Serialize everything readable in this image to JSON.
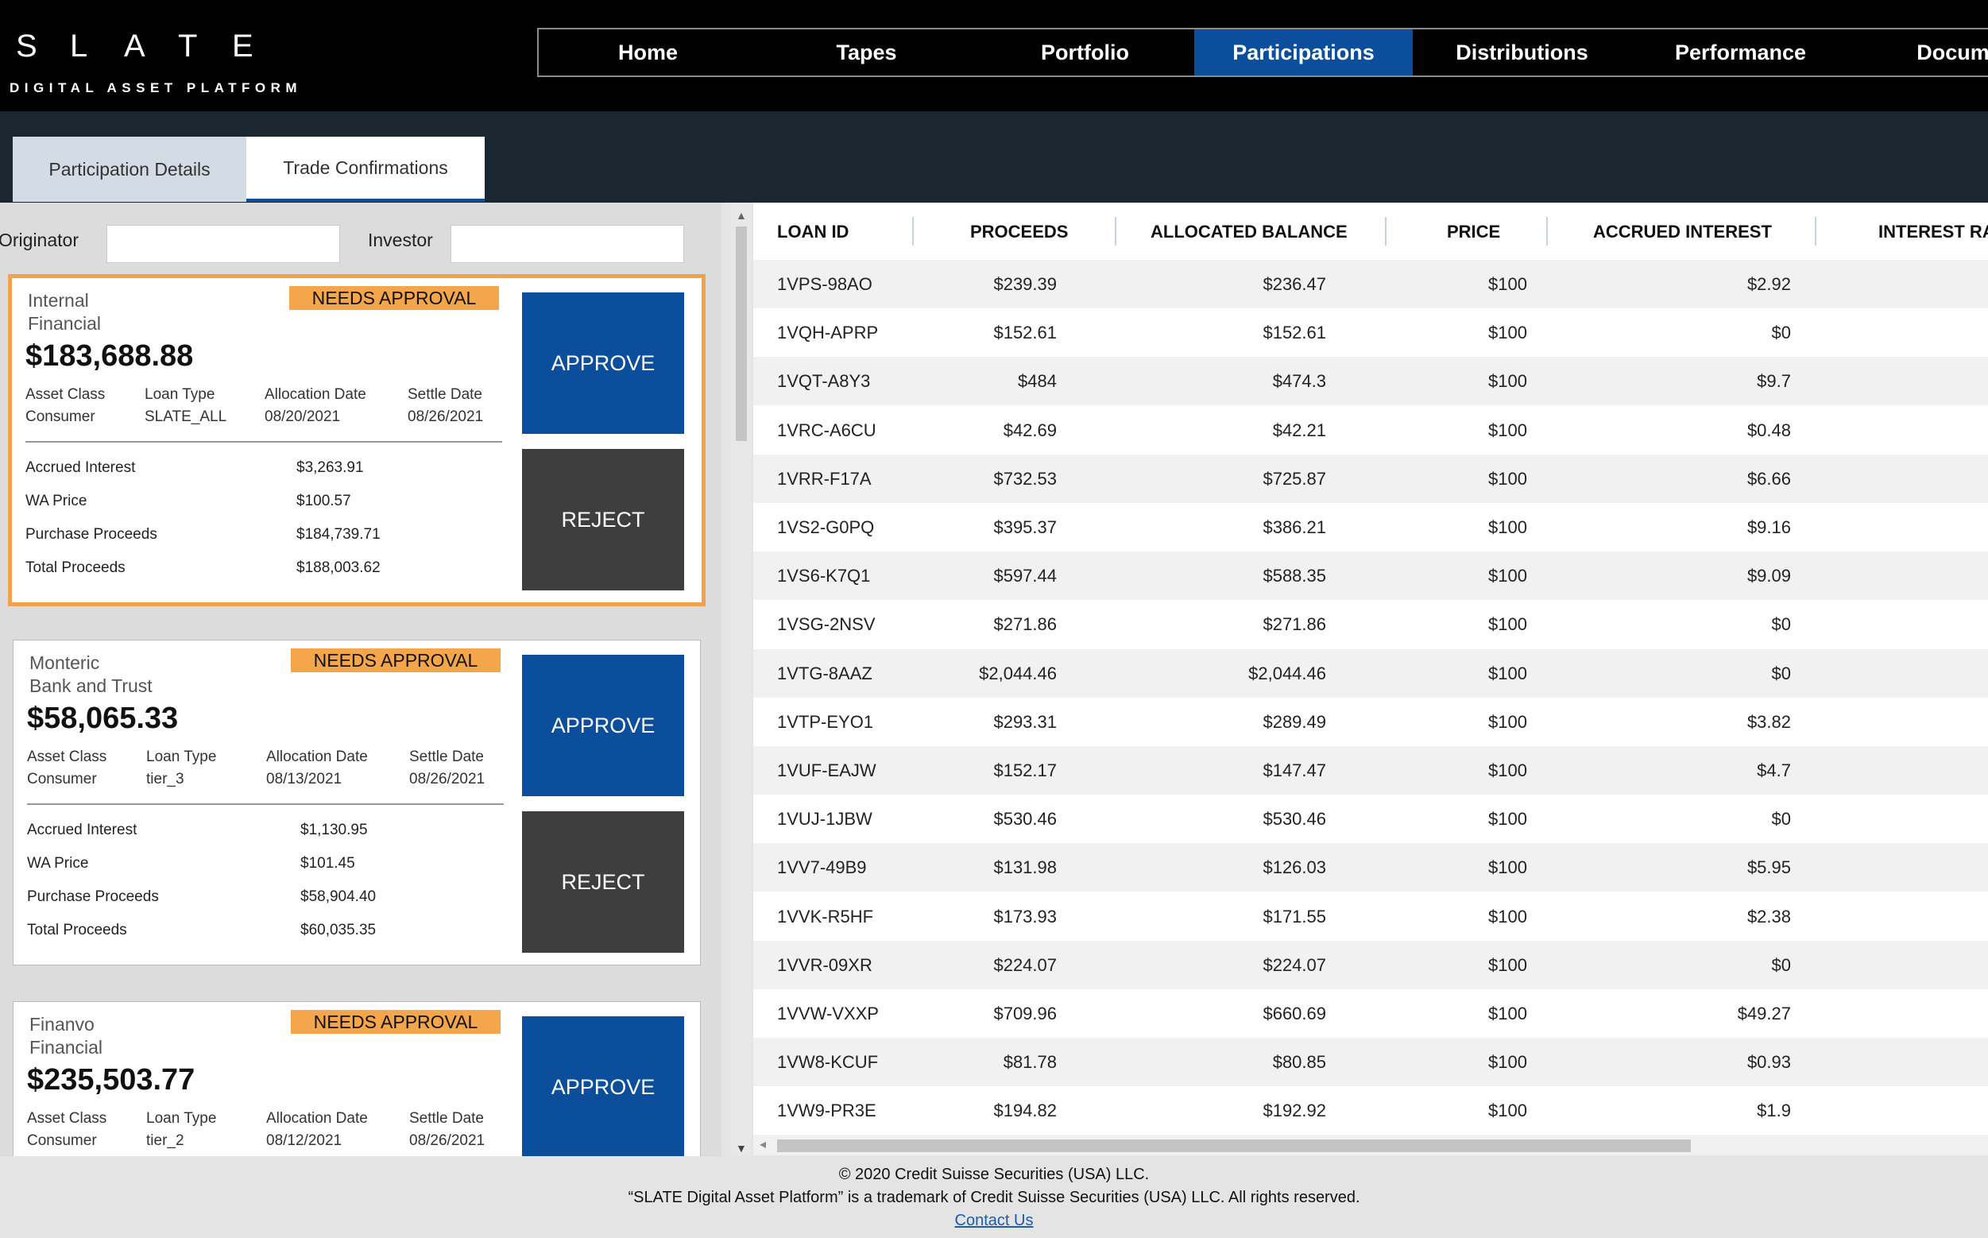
{
  "brand": {
    "name_letters": [
      "S",
      "L",
      "A",
      "T",
      "E"
    ],
    "tagline": "DIGITAL ASSET PLATFORM"
  },
  "nav": {
    "items": [
      "Home",
      "Tapes",
      "Portfolio",
      "Participations",
      "Distributions",
      "Performance",
      "Docume"
    ],
    "active_index": 3
  },
  "colors": {
    "accent": "#0b4f9c",
    "badge": "#f5a54a",
    "reject": "#3e3e3e",
    "header_bg": "#000000",
    "subheader_bg": "#1a2630"
  },
  "tabs": {
    "details": "Participation Details",
    "trade": "Trade Confirmations"
  },
  "filters": {
    "originator_label": "Originator",
    "investor_label": "Investor",
    "originator_value": "",
    "investor_value": ""
  },
  "labels": {
    "badge": "NEEDS APPROVAL",
    "asset_class": "Asset Class",
    "loan_type": "Loan Type",
    "allocation_date": "Allocation Date",
    "settle_date": "Settle Date",
    "accrued_interest": "Accrued Interest",
    "wa_price": "WA Price",
    "purchase_proceeds": "Purchase Proceeds",
    "total_proceeds": "Total Proceeds",
    "approve": "APPROVE",
    "reject": "REJECT"
  },
  "cards": [
    {
      "org_line1": "Internal",
      "org_line2": "Financial",
      "amount": "$183,688.88",
      "asset_class": "Consumer",
      "loan_type": "SLATE_ALL",
      "allocation_date": "08/20/2021",
      "settle_date": "08/26/2021",
      "accrued_interest": "$3,263.91",
      "wa_price": "$100.57",
      "purchase_proceeds": "$184,739.71",
      "total_proceeds": "$188,003.62"
    },
    {
      "org_line1": "Monteric",
      "org_line2": "Bank and Trust",
      "amount": "$58,065.33",
      "asset_class": "Consumer",
      "loan_type": "tier_3",
      "allocation_date": "08/13/2021",
      "settle_date": "08/26/2021",
      "accrued_interest": "$1,130.95",
      "wa_price": "$101.45",
      "purchase_proceeds": "$58,904.40",
      "total_proceeds": "$60,035.35"
    },
    {
      "org_line1": "Finanvo",
      "org_line2": "Financial",
      "amount": "$235,503.77",
      "asset_class": "Consumer",
      "loan_type": "tier_2",
      "allocation_date": "08/12/2021",
      "settle_date": "08/26/2021"
    }
  ],
  "table": {
    "headers": [
      "LOAN ID",
      "PROCEEDS",
      "ALLOCATED BALANCE",
      "PRICE",
      "ACCRUED INTEREST",
      "INTEREST RA"
    ],
    "rows": [
      [
        "1VPS-98AO",
        "$239.39",
        "$236.47",
        "$100",
        "$2.92"
      ],
      [
        "1VQH-APRP",
        "$152.61",
        "$152.61",
        "$100",
        "$0"
      ],
      [
        "1VQT-A8Y3",
        "$484",
        "$474.3",
        "$100",
        "$9.7"
      ],
      [
        "1VRC-A6CU",
        "$42.69",
        "$42.21",
        "$100",
        "$0.48"
      ],
      [
        "1VRR-F17A",
        "$732.53",
        "$725.87",
        "$100",
        "$6.66"
      ],
      [
        "1VS2-G0PQ",
        "$395.37",
        "$386.21",
        "$100",
        "$9.16"
      ],
      [
        "1VS6-K7Q1",
        "$597.44",
        "$588.35",
        "$100",
        "$9.09"
      ],
      [
        "1VSG-2NSV",
        "$271.86",
        "$271.86",
        "$100",
        "$0"
      ],
      [
        "1VTG-8AAZ",
        "$2,044.46",
        "$2,044.46",
        "$100",
        "$0"
      ],
      [
        "1VTP-EYO1",
        "$293.31",
        "$289.49",
        "$100",
        "$3.82"
      ],
      [
        "1VUF-EAJW",
        "$152.17",
        "$147.47",
        "$100",
        "$4.7"
      ],
      [
        "1VUJ-1JBW",
        "$530.46",
        "$530.46",
        "$100",
        "$0"
      ],
      [
        "1VV7-49B9",
        "$131.98",
        "$126.03",
        "$100",
        "$5.95"
      ],
      [
        "1VVK-R5HF",
        "$173.93",
        "$171.55",
        "$100",
        "$2.38"
      ],
      [
        "1VVR-09XR",
        "$224.07",
        "$224.07",
        "$100",
        "$0"
      ],
      [
        "1VVW-VXXP",
        "$709.96",
        "$660.69",
        "$100",
        "$49.27"
      ],
      [
        "1VW8-KCUF",
        "$81.78",
        "$80.85",
        "$100",
        "$0.93"
      ],
      [
        "1VW9-PR3E",
        "$194.82",
        "$192.92",
        "$100",
        "$1.9"
      ]
    ]
  },
  "footer": {
    "copyright": "© 2020 Credit Suisse Securities (USA) LLC.",
    "trademark": "“SLATE Digital Asset Platform” is a trademark of Credit Suisse Securities (USA) LLC. All rights reserved.",
    "contact": "Contact Us"
  }
}
